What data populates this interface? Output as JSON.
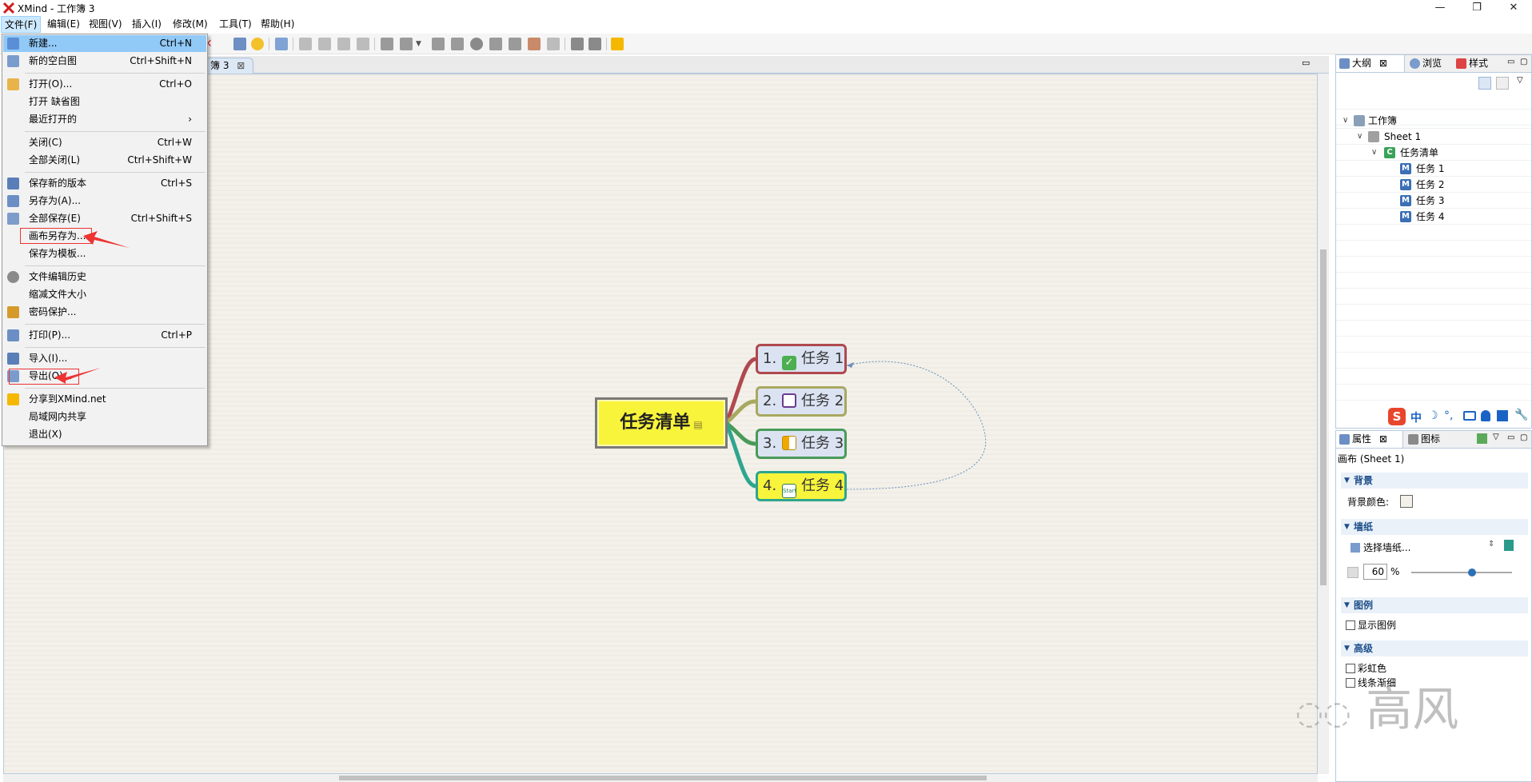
{
  "window": {
    "title": "XMind - 工作簿 3",
    "buttons": [
      "—",
      "❐",
      "✕"
    ]
  },
  "menubar": [
    {
      "label": "文件(F)",
      "active": true
    },
    {
      "label": "编辑(E)"
    },
    {
      "label": "视图(V)"
    },
    {
      "label": "插入(I)"
    },
    {
      "label": "修改(M)"
    },
    {
      "label": "工具(T)"
    },
    {
      "label": "帮助(H)"
    }
  ],
  "file_menu": {
    "items": [
      {
        "label": "新建...",
        "shortcut": "Ctrl+N",
        "icon": "new-icon",
        "highlighted": true
      },
      {
        "label": "新的空白图",
        "shortcut": "Ctrl+Shift+N",
        "icon": "blank-map-icon"
      },
      {
        "label": "打开(O)...",
        "shortcut": "Ctrl+O",
        "icon": "open-folder-icon"
      },
      {
        "label": "打开 缺省图",
        "shortcut": ""
      },
      {
        "label": "最近打开的",
        "shortcut": "›"
      },
      {
        "label": "关闭(C)",
        "shortcut": "Ctrl+W"
      },
      {
        "label": "全部关闭(L)",
        "shortcut": "Ctrl+Shift+W"
      },
      {
        "label": "保存新的版本",
        "shortcut": "Ctrl+S",
        "icon": "save-icon"
      },
      {
        "label": "另存为(A)...",
        "shortcut": "",
        "icon": "save-as-icon"
      },
      {
        "label": "全部保存(E)",
        "shortcut": "Ctrl+Shift+S",
        "icon": "save-all-icon"
      },
      {
        "label": "画布另存为...",
        "shortcut": "",
        "boxed": true
      },
      {
        "label": "保存为模板...",
        "shortcut": ""
      },
      {
        "label": "文件编辑历史",
        "shortcut": "",
        "icon": "history-icon"
      },
      {
        "label": "缩减文件大小",
        "shortcut": ""
      },
      {
        "label": "密码保护...",
        "shortcut": "",
        "icon": "lock-icon"
      },
      {
        "label": "打印(P)...",
        "shortcut": "Ctrl+P",
        "icon": "print-icon"
      },
      {
        "label": "导入(I)...",
        "shortcut": "",
        "icon": "import-icon"
      },
      {
        "label": "导出(O)...",
        "shortcut": "",
        "icon": "export-icon",
        "boxed": true
      },
      {
        "label": "分享到XMind.net",
        "shortcut": "",
        "icon": "share-arrow-icon"
      },
      {
        "label": "局域网内共享",
        "shortcut": ""
      },
      {
        "label": "退出(X)",
        "shortcut": ""
      }
    ]
  },
  "editor": {
    "tab_label": "簿 3",
    "central_topic": "任务清单",
    "tasks": [
      {
        "number": "1.",
        "label": "任务 1",
        "icon": "checkbox-done-icon",
        "border": "#b0484f",
        "fill": "#dbe3f2"
      },
      {
        "number": "2.",
        "label": "任务 2",
        "icon": "page-icon",
        "border": "#a8a860",
        "fill": "#dbe3f2"
      },
      {
        "number": "3.",
        "label": "任务 3",
        "icon": "half-progress-icon",
        "border": "#4a9a5a",
        "fill": "#dbe3f2"
      },
      {
        "number": "4.",
        "label": "任务 4",
        "icon": "start-icon",
        "icon_text": "Start",
        "border": "#2ea58e",
        "fill": "#f8f43b"
      }
    ]
  },
  "outline_panel": {
    "tabs": [
      {
        "label": "大纲",
        "icon": "outline-icon",
        "selected": true
      },
      {
        "label": "浏览",
        "icon": "browse-icon"
      },
      {
        "label": "样式",
        "icon": "style-icon"
      }
    ],
    "tree": [
      {
        "label": "工作簿",
        "level": 0,
        "icon": "workbook-icon",
        "expanded": true
      },
      {
        "label": "Sheet 1",
        "level": 1,
        "icon": "sheet-icon",
        "expanded": true
      },
      {
        "label": "任务清单",
        "level": 2,
        "icon": "central-topic-icon",
        "icon_letter": "C",
        "expanded": true
      },
      {
        "label": "任务 1",
        "level": 3,
        "icon": "main-topic-icon",
        "icon_letter": "M"
      },
      {
        "label": "任务 2",
        "level": 3,
        "icon": "main-topic-icon",
        "icon_letter": "M"
      },
      {
        "label": "任务 3",
        "level": 3,
        "icon": "main-topic-icon",
        "icon_letter": "M"
      },
      {
        "label": "任务 4",
        "level": 3,
        "icon": "main-topic-icon",
        "icon_letter": "M"
      }
    ]
  },
  "props_panel": {
    "tabs": [
      {
        "label": "属性",
        "icon": "properties-icon",
        "selected": true
      },
      {
        "label": "图标",
        "icon": "markers-icon"
      }
    ],
    "subtitle": "画布 (Sheet 1)",
    "sections": {
      "background": {
        "title": "背景",
        "color_label": "背景颜色:",
        "color": "#f3f1e9"
      },
      "wallpaper": {
        "title": "墙纸",
        "select_label": "选择墙纸...",
        "opacity_value": "60",
        "opacity_unit": "%",
        "slider_fraction": 0.6
      },
      "legend": {
        "title": "图例",
        "show_label": "显示图例"
      },
      "advanced": {
        "title": "高级",
        "rainbow_label": "彩虹色",
        "taper_label": "线条渐细"
      }
    }
  },
  "ime": {
    "label": "中"
  },
  "watermark": {
    "text": "高风"
  }
}
